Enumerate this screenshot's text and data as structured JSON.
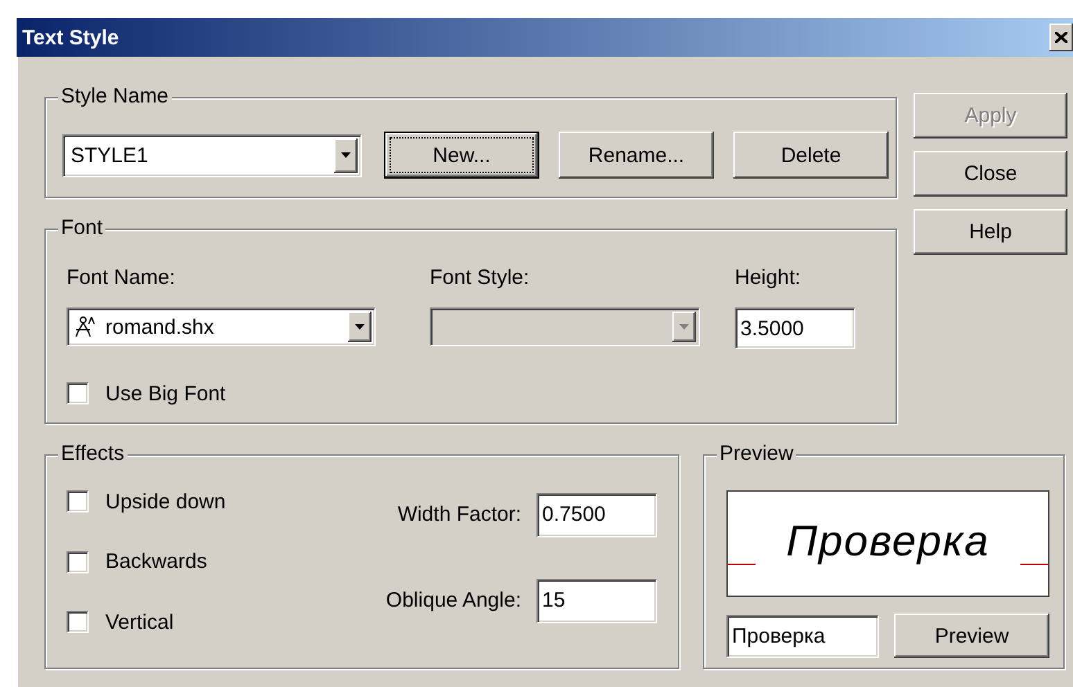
{
  "window": {
    "title": "Text Style"
  },
  "style_name": {
    "label": "Style Name",
    "value": "STYLE1",
    "buttons": [
      {
        "label": "New...",
        "focused": true
      },
      {
        "label": "Rename...",
        "focused": false
      },
      {
        "label": "Delete",
        "focused": false
      }
    ]
  },
  "side_buttons": [
    {
      "label": "Apply",
      "disabled": true
    },
    {
      "label": "Close",
      "disabled": false
    },
    {
      "label": "Help",
      "disabled": false
    }
  ],
  "font": {
    "label": "Font",
    "font_name": {
      "label": "Font Name:",
      "value": "romand.shx"
    },
    "font_style": {
      "label": "Font Style:",
      "disabled": true
    },
    "height": {
      "label": "Height:",
      "value": "3.5000"
    },
    "big_font": {
      "label": "Use Big Font",
      "checked": false
    }
  },
  "effects": {
    "label": "Effects",
    "checks": [
      {
        "label": "Upside down",
        "checked": false
      },
      {
        "label": "Backwards",
        "checked": false
      },
      {
        "label": "Vertical",
        "checked": false
      }
    ],
    "fields": [
      {
        "label": "Width Factor:",
        "value": "0.7500"
      },
      {
        "label": "Oblique Angle:",
        "value": "15"
      }
    ]
  },
  "preview": {
    "label": "Preview",
    "sample": "Проверка",
    "input": "Проверка",
    "button": "Preview"
  }
}
